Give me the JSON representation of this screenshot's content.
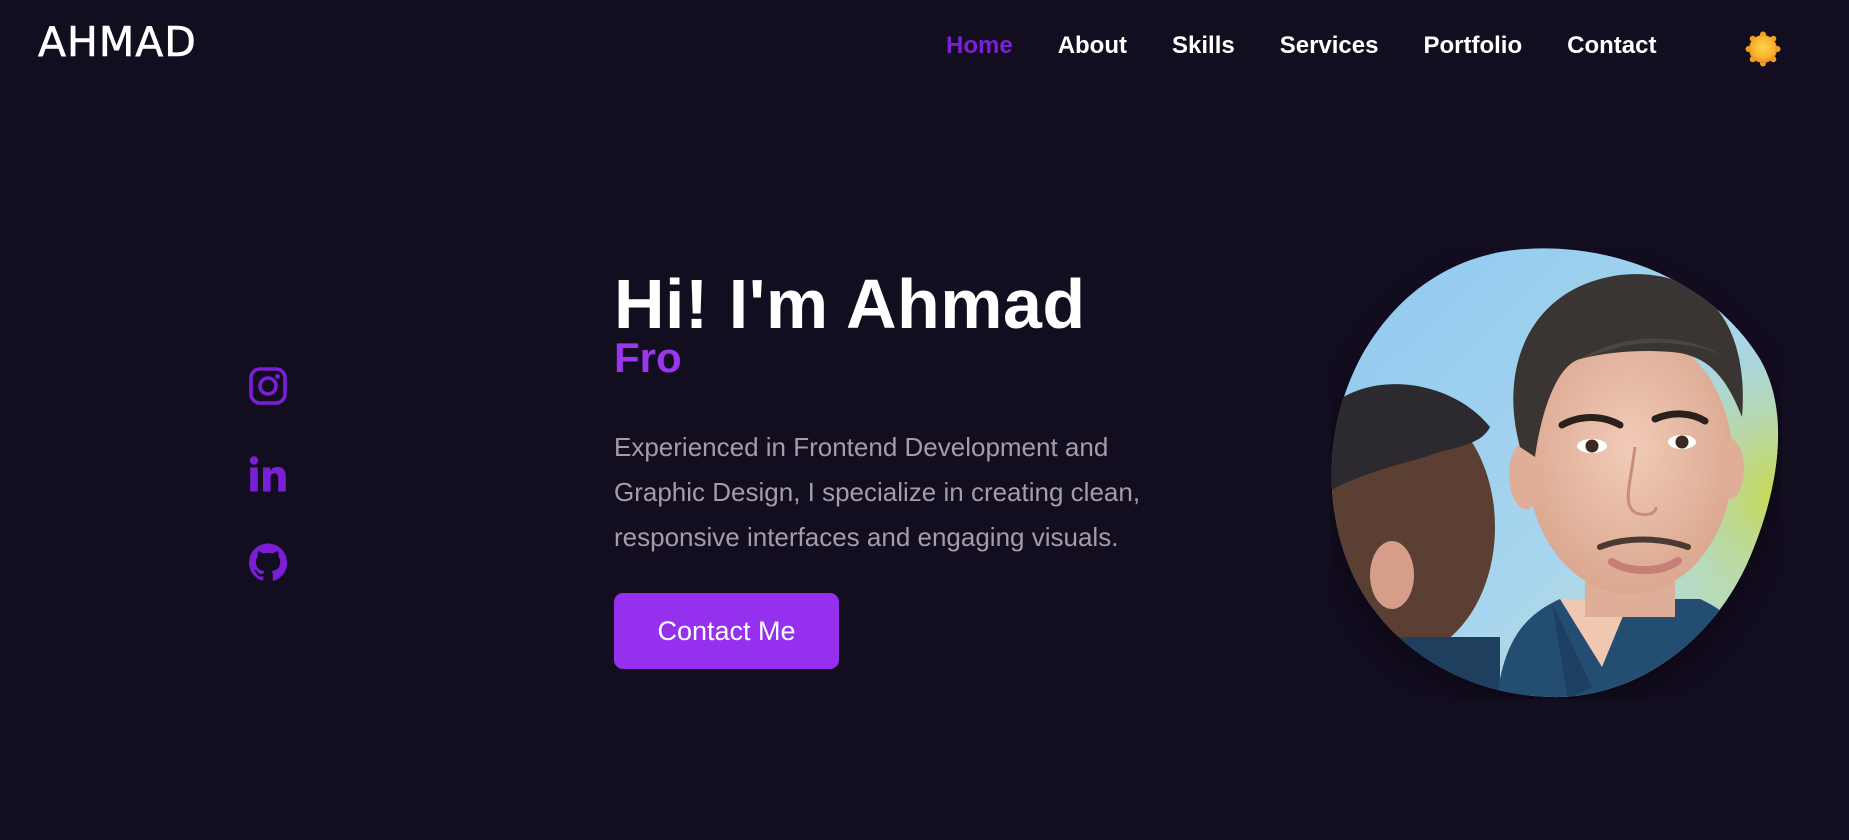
{
  "brand": {
    "logo_text": "AHMAD"
  },
  "nav": {
    "items": [
      {
        "label": "Home",
        "active": true
      },
      {
        "label": "About",
        "active": false
      },
      {
        "label": "Skills",
        "active": false
      },
      {
        "label": "Services",
        "active": false
      },
      {
        "label": "Portfolio",
        "active": false
      },
      {
        "label": "Contact",
        "active": false
      }
    ],
    "theme_toggle_icon": "sun-icon"
  },
  "socials": [
    {
      "icon": "instagram-icon"
    },
    {
      "icon": "linkedin-icon"
    },
    {
      "icon": "github-icon"
    }
  ],
  "hero": {
    "title": "Hi! I'm Ahmad",
    "typed_subtitle": "Fro",
    "description": "Experienced in Frontend Development and Graphic Design, I specialize in creating clean, responsive interfaces and engaging visuals.",
    "cta_label": "Contact Me",
    "portrait_icon": "profile-photo"
  },
  "colors": {
    "background": "#130d20",
    "accent": "#9530ef",
    "active_nav": "#7a1fd6",
    "muted_text": "#a39dab",
    "text": "#ffffff"
  }
}
